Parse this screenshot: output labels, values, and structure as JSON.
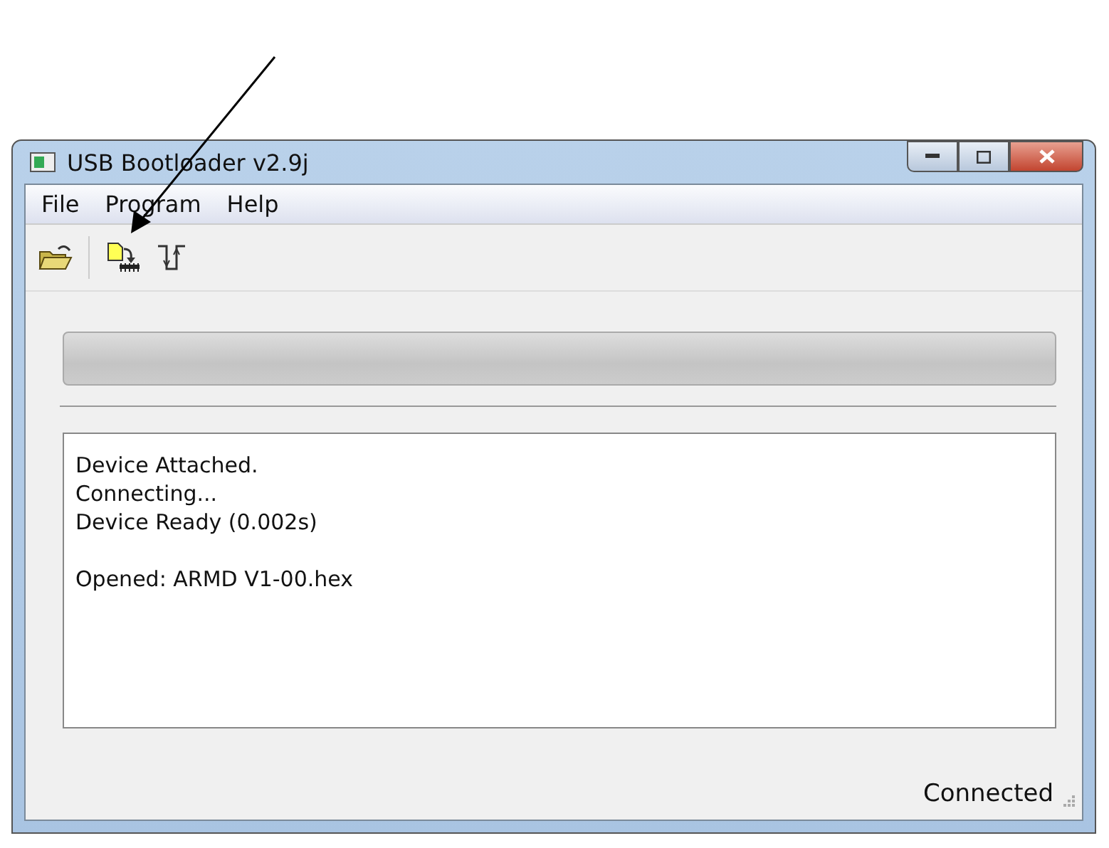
{
  "window": {
    "title": "USB Bootloader v2.9j"
  },
  "menu": [
    {
      "label": "File"
    },
    {
      "label": "Program"
    },
    {
      "label": "Help"
    }
  ],
  "toolbar": [
    {
      "kind": "open"
    },
    {
      "kind": "write"
    },
    {
      "kind": "reset"
    }
  ],
  "log": [
    [
      "Device Attached.",
      "Connecting...",
      "Device Ready (0.002s)"
    ],
    [
      "Opened: ARMD V1-00.hex"
    ]
  ],
  "status_bar": {
    "text": "Connected"
  }
}
